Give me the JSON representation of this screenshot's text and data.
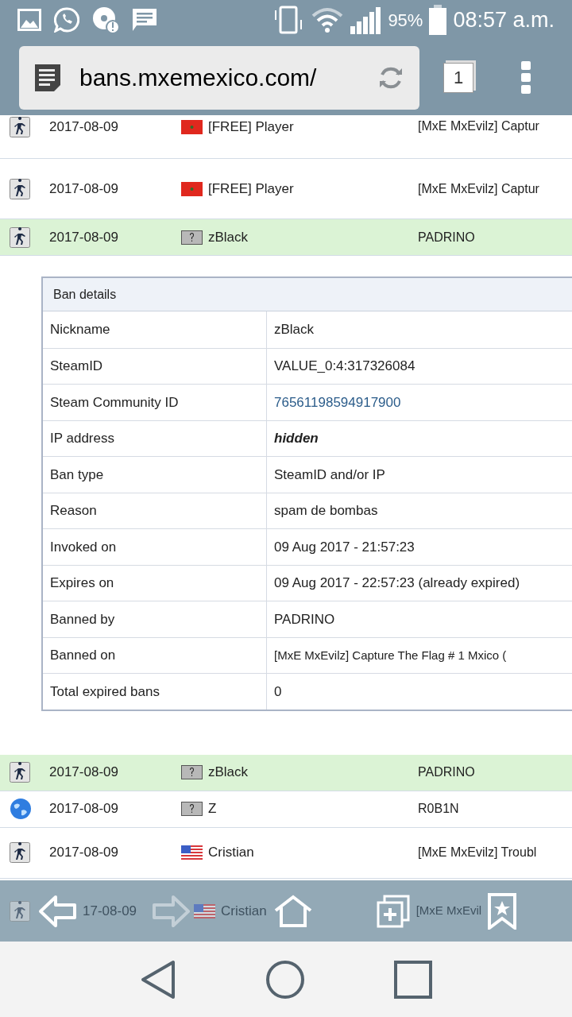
{
  "status_bar": {
    "battery": "95%",
    "time": "08:57 a.m."
  },
  "address_bar": {
    "url": "bans.mxemexico.com/",
    "tab_count": "1"
  },
  "bans_top": [
    {
      "kind": "game",
      "date": "2017-08-09",
      "flag": {
        "kind": "ma"
      },
      "player": "[FREE] Player",
      "admin": "[MxE MxEvilz] Captur",
      "selected": false
    },
    {
      "kind": "game",
      "date": "2017-08-09",
      "flag": {
        "kind": "ma"
      },
      "player": "[FREE] Player",
      "admin": "[MxE MxEvilz] Captur",
      "selected": false
    },
    {
      "kind": "game",
      "date": "2017-08-09",
      "flag": {
        "kind": "unknown"
      },
      "player": "zBlack",
      "admin": "PADRINO",
      "selected": true
    }
  ],
  "ban_details": {
    "title": "Ban details",
    "rows": [
      {
        "label": "Nickname",
        "value": "zBlack",
        "kind": "plain"
      },
      {
        "label": "SteamID",
        "value": "VALUE_0:4:317326084",
        "kind": "plain"
      },
      {
        "label": "Steam Community ID",
        "value": "76561198594917900",
        "kind": "link"
      },
      {
        "label": "IP address",
        "value": "hidden",
        "kind": "hidden"
      },
      {
        "label": "Ban type",
        "value": "SteamID and/or IP",
        "kind": "plain"
      },
      {
        "label": "Reason",
        "value": "spam de bombas",
        "kind": "plain"
      },
      {
        "label": "Invoked on",
        "value": "09 Aug 2017 - 21:57:23",
        "kind": "plain"
      },
      {
        "label": "Expires on",
        "value": "09 Aug 2017 - 22:57:23 (already expired)",
        "kind": "plain"
      },
      {
        "label": "Banned by",
        "value": "PADRINO",
        "kind": "plain"
      },
      {
        "label": "Banned on",
        "value": "[MxE MxEvilz] Capture The Flag # 1 Mxico (",
        "kind": "plain"
      },
      {
        "label": "Total expired bans",
        "value": "0",
        "kind": "plain"
      }
    ]
  },
  "bans_bottom": [
    {
      "kind": "game",
      "date": "2017-08-09",
      "flag": {
        "kind": "unknown"
      },
      "player": "zBlack",
      "admin": "PADRINO",
      "selected": true
    },
    {
      "kind": "web",
      "date": "2017-08-09",
      "flag": {
        "kind": "unknown"
      },
      "player": "Z",
      "admin": "R0B1N",
      "selected": false
    },
    {
      "kind": "game",
      "date": "2017-08-09",
      "flag": {
        "kind": "us"
      },
      "player": "Cristian",
      "admin": "[MxE MxEvilz] Troubl",
      "selected": false
    },
    {
      "kind": "game",
      "date": "17-08-09",
      "flag": {
        "kind": "us"
      },
      "player": "Cristian",
      "admin": "[MxE MxEvil"
    }
  ],
  "toolbar": {
    "forward": {
      "disabled": true
    }
  }
}
